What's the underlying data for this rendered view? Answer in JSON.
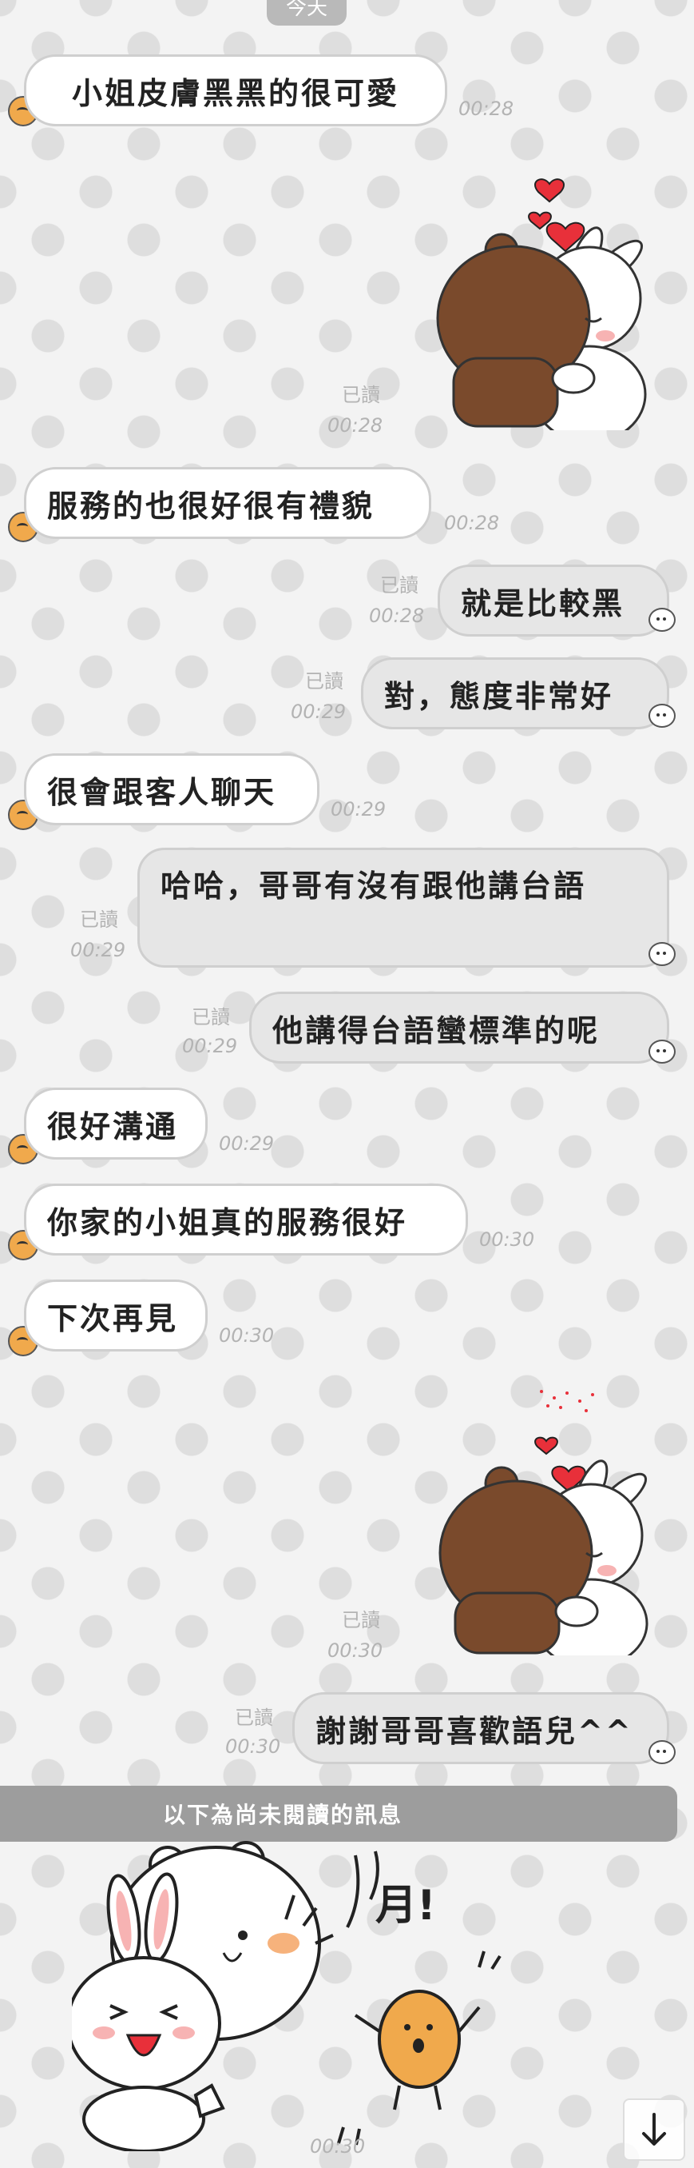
{
  "date_label": "今天",
  "messages": [
    {
      "text": "小姐皮膚黑黑的很可愛",
      "time": "00:28"
    },
    {
      "read": "已讀",
      "time": "00:28"
    },
    {
      "text": "服務的也很好很有禮貌",
      "time": "00:28"
    },
    {
      "text": "就是比較黑",
      "read": "已讀",
      "time": "00:28"
    },
    {
      "text": "對，態度非常好",
      "read": "已讀",
      "time": "00:29"
    },
    {
      "text": "很會跟客人聊天",
      "time": "00:29"
    },
    {
      "text": "哈哈，哥哥有沒有跟他講台語",
      "read": "已讀",
      "time": "00:29"
    },
    {
      "text": "他講得台語蠻標準的呢",
      "read": "已讀",
      "time": "00:29"
    },
    {
      "text": "很好溝通",
      "time": "00:29"
    },
    {
      "text": "你家的小姐真的服務很好",
      "time": "00:30"
    },
    {
      "text": "下次再見",
      "time": "00:30"
    },
    {
      "read": "已讀",
      "time": "00:30"
    },
    {
      "text": "謝謝哥哥喜歡語兒^^",
      "read": "已讀",
      "time": "00:30"
    },
    {
      "time": "00:30"
    }
  ],
  "unread_divider": "以下為尚未閱讀的訊息",
  "sticker_text": "月!",
  "colors": {
    "accent": "#9d9d9d",
    "bubble_right": "#e6e6e6",
    "bubble_left": "#ffffff",
    "avatar": "#f0a94c"
  }
}
